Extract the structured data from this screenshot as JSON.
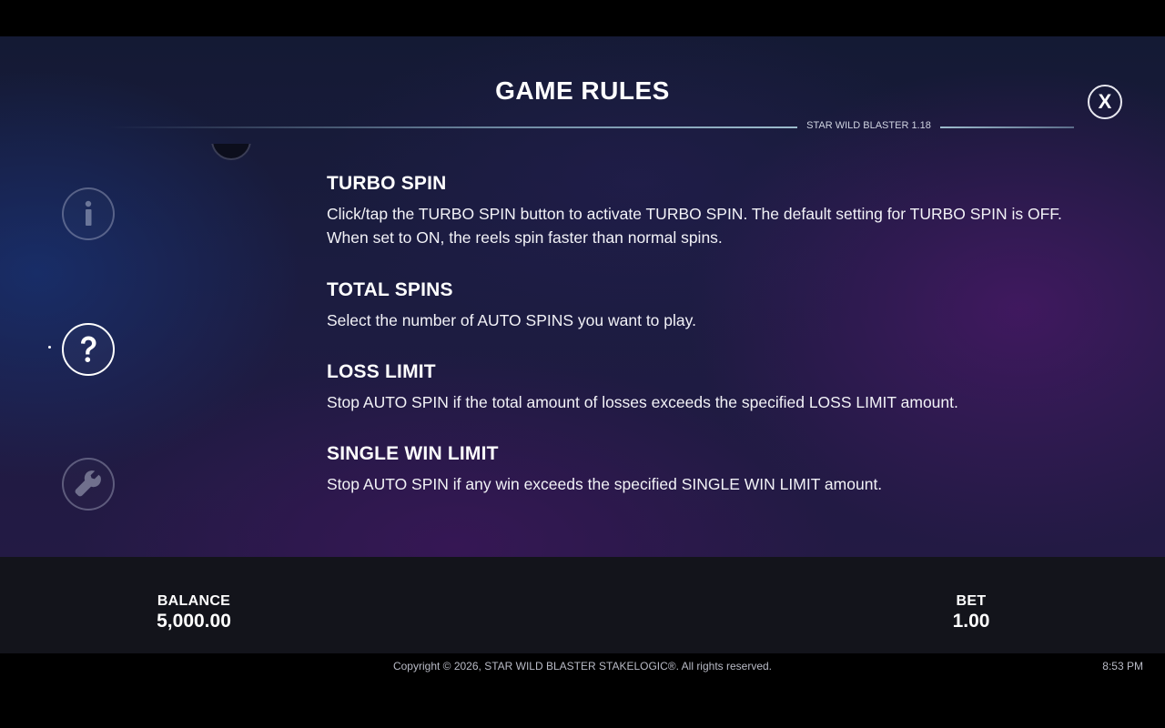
{
  "header": {
    "title": "GAME RULES",
    "version": "STAR WILD BLASTER 1.18",
    "close_label": "X"
  },
  "sidebar": {
    "items": [
      {
        "icon": "info-icon",
        "active": false
      },
      {
        "icon": "help-question-icon",
        "active": true
      },
      {
        "icon": "wrench-settings-icon",
        "active": false
      }
    ]
  },
  "rules": {
    "sections": [
      {
        "heading": "TURBO SPIN",
        "body": "Click/tap the TURBO SPIN button to activate TURBO SPIN. The default setting for TURBO SPIN is OFF. When set to ON, the reels spin faster than normal spins."
      },
      {
        "heading": "TOTAL SPINS",
        "body": "Select the number of AUTO SPINS you want to play."
      },
      {
        "heading": "LOSS LIMIT",
        "body": "Stop AUTO SPIN if the total amount of losses exceeds the specified LOSS LIMIT amount."
      },
      {
        "heading": "SINGLE WIN LIMIT",
        "body": "Stop AUTO SPIN if any win exceeds the specified SINGLE WIN LIMIT amount."
      }
    ]
  },
  "bottom_bar": {
    "balance_label": "BALANCE",
    "balance_value": "5,000.00",
    "bet_label": "BET",
    "bet_value": "1.00"
  },
  "footer": {
    "copyright": "Copyright © 2026, STAR WILD BLASTER STAKELOGIC®. All rights reserved.",
    "time": "8:53 PM"
  },
  "colors": {
    "background_blue": "#18306e",
    "background_purple": "#46186a",
    "bar": "#13141b",
    "text": "#ffffff"
  }
}
